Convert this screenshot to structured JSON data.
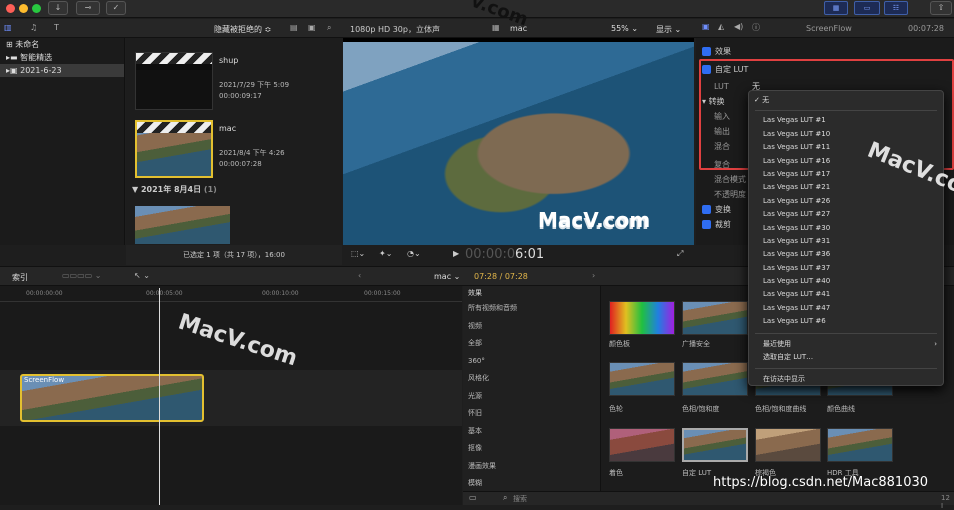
{
  "toolbar": {
    "filter_label": "隐藏被拒绝的 ≎",
    "format_label": "1080p HD 30p，立体声",
    "clip_name": "mac",
    "zoom_label": "55% ⌄",
    "view_label": "显示 ⌄",
    "inspector_title": "ScreenFlow",
    "inspector_time": "00:07:28"
  },
  "library": {
    "items": [
      "未命名",
      "智能精选",
      "2021-6-23"
    ]
  },
  "browser": {
    "clips": [
      {
        "name": "shup",
        "date": "2021/7/29 下午 5:09",
        "duration": "00:00:09:17"
      },
      {
        "name": "mac",
        "date": "2021/8/4 下午 4:26",
        "duration": "00:00:07:28"
      }
    ],
    "section_header": "▼ 2021年 8月4日",
    "section_count": "(1)",
    "status": "已选定 1 项（共 17 项），16:00"
  },
  "viewer": {
    "timecode": "6:01",
    "timecode_prefix": "00:00:0"
  },
  "inspector": {
    "effects_label": "效果",
    "custom_lut_label": "自定 LUT",
    "lut_label": "LUT",
    "lut_value": "无",
    "transform_label": "转换",
    "input_label": "输入",
    "output_label": "输出",
    "mix_label": "混合",
    "composite_label": "复合",
    "blend_mode_label": "混合模式",
    "opacity_label": "不透明度",
    "transform2_label": "变换",
    "crop_label": "裁剪"
  },
  "lut_menu": {
    "none": "无",
    "items": [
      "Las Vegas LUT #1",
      "Las Vegas LUT #10",
      "Las Vegas LUT #11",
      "Las Vegas LUT #16",
      "Las Vegas LUT #17",
      "Las Vegas LUT #21",
      "Las Vegas LUT #26",
      "Las Vegas LUT #27",
      "Las Vegas LUT #30",
      "Las Vegas LUT #31",
      "Las Vegas LUT #36",
      "Las Vegas LUT #37",
      "Las Vegas LUT #40",
      "Las Vegas LUT #41",
      "Las Vegas LUT #47",
      "Las Vegas LUT #6"
    ],
    "recent": "最近使用",
    "choose": "选取自定 LUT…",
    "reveal": "在访达中显示"
  },
  "timeline": {
    "index_label": "索引",
    "project_label": "mac ⌄",
    "time_display": "07:28 / 07:28",
    "ruler": [
      "00:00:00:00",
      "00:00:05:00",
      "00:00:10:00",
      "00:00:15:00"
    ],
    "clip_label": "ScreenFlow"
  },
  "effects": {
    "title": "效果",
    "categories": [
      "所有视频和音频",
      "视频",
      "全部",
      "360°",
      "风格化",
      "光源",
      "怀旧",
      "基本",
      "抠像",
      "漫画效果",
      "模糊"
    ],
    "thumbs": [
      "颜色板",
      "广播安全",
      "色轮",
      "色相/饱和度",
      "色相/饱和度曲线",
      "颜色曲线",
      "着色",
      "自定 LUT",
      "棕褐色",
      "HDR 工具"
    ],
    "search_placeholder": "搜索",
    "count": "12 I"
  },
  "watermarks": {
    "w1": "MacV.com",
    "w2": "Macv.com",
    "w3": "MacV.com",
    "w4": "MacV.com",
    "w5": "v.com",
    "credit": "https://blog.csdn.net/Mac881030"
  }
}
